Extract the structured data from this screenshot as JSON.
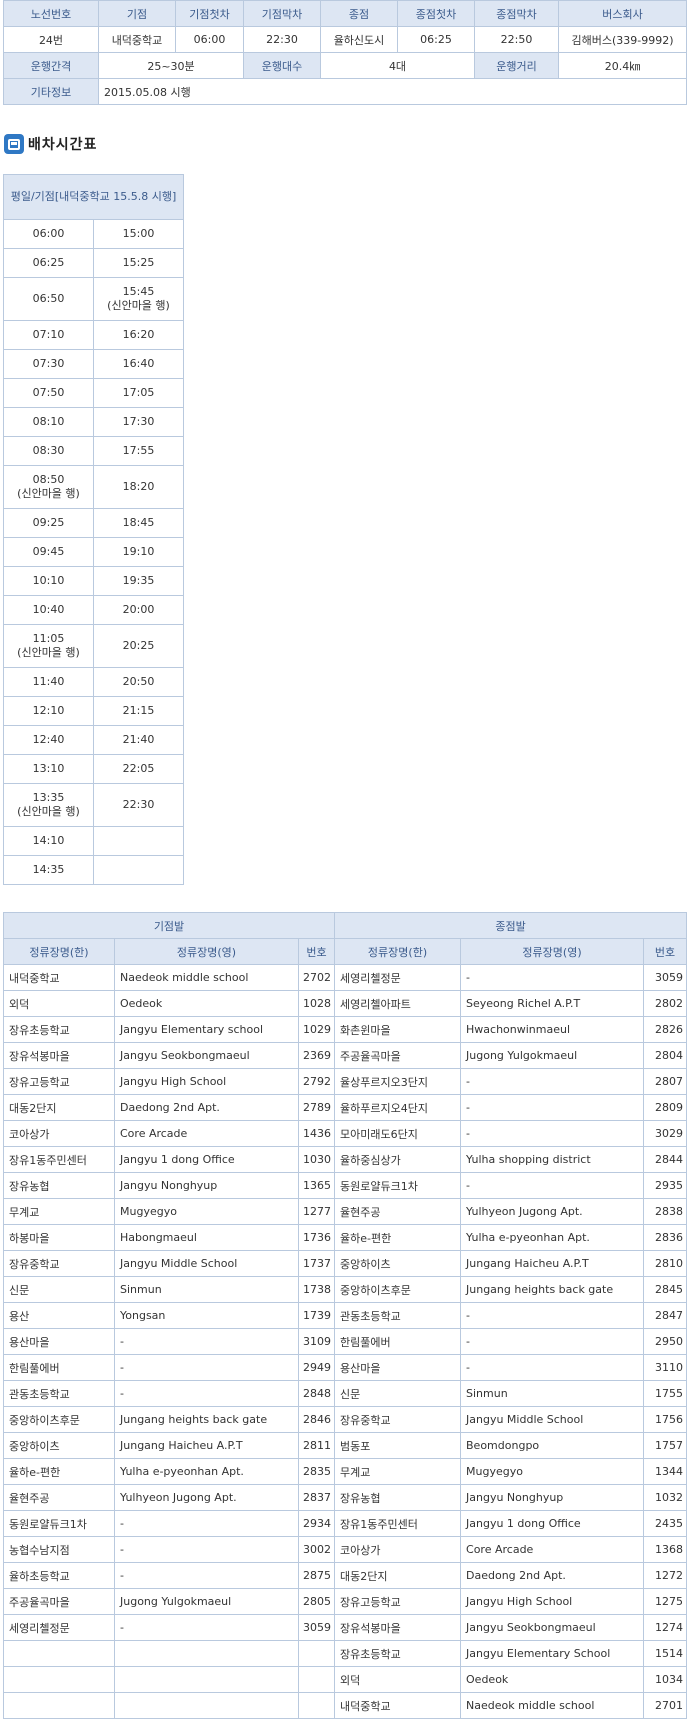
{
  "info": {
    "headers": [
      "노선번호",
      "기점",
      "기점첫차",
      "기점막차",
      "종점",
      "종점첫차",
      "종점막차",
      "버스회사"
    ],
    "values": [
      "24번",
      "내덕중학교",
      "06:00",
      "22:30",
      "율하신도시",
      "06:25",
      "22:50",
      "김해버스(339-9992)"
    ],
    "interval_label": "운행간격",
    "interval_value": "25~30분",
    "count_label": "운행대수",
    "count_value": "4대",
    "distance_label": "운행거리",
    "distance_value": "20.4㎞",
    "etc_label": "기타정보",
    "etc_value": "2015.05.08 시행"
  },
  "schedule": {
    "title": "배차시간표",
    "header": "평일/기점[내덕중학교 15.5.8 시행]",
    "rows": [
      [
        "06:00",
        "15:00"
      ],
      [
        "06:25",
        "15:25"
      ],
      [
        "06:50",
        "15:45\n(신안마을 행)"
      ],
      [
        "07:10",
        "16:20"
      ],
      [
        "07:30",
        "16:40"
      ],
      [
        "07:50",
        "17:05"
      ],
      [
        "08:10",
        "17:30"
      ],
      [
        "08:30",
        "17:55"
      ],
      [
        "08:50\n(신안마을 행)",
        "18:20"
      ],
      [
        "09:25",
        "18:45"
      ],
      [
        "09:45",
        "19:10"
      ],
      [
        "10:10",
        "19:35"
      ],
      [
        "10:40",
        "20:00"
      ],
      [
        "11:05\n(신안마을 행)",
        "20:25"
      ],
      [
        "11:40",
        "20:50"
      ],
      [
        "12:10",
        "21:15"
      ],
      [
        "12:40",
        "21:40"
      ],
      [
        "13:10",
        "22:05"
      ],
      [
        "13:35\n(신안마을 행)",
        "22:30"
      ],
      [
        "14:10",
        ""
      ],
      [
        "14:35",
        ""
      ]
    ]
  },
  "stops": {
    "origin_header": "기점발",
    "dest_header": "종점발",
    "col_ko": "정류장명(한)",
    "col_en": "정류장명(영)",
    "col_no": "번호",
    "rows": [
      [
        "내덕중학교",
        "Naedeok middle school",
        "2702",
        "세영리첼정문",
        "-",
        "3059"
      ],
      [
        "외덕",
        "Oedeok",
        "1028",
        "세영리첼아파트",
        "Seyeong Richel A.P.T",
        "2802"
      ],
      [
        "장유초등학교",
        "Jangyu Elementary school",
        "1029",
        "화촌윈마을",
        "Hwachonwinmaeul",
        "2826"
      ],
      [
        "장유석봉마을",
        "Jangyu Seokbongmaeul",
        "2369",
        "주공율곡마을",
        "Jugong Yulgokmaeul",
        "2804"
      ],
      [
        "장유고등학교",
        "Jangyu High School",
        "2792",
        "율상푸르지오3단지",
        "-",
        "2807"
      ],
      [
        "대동2단지",
        "Daedong 2nd Apt.",
        "2789",
        "율하푸르지오4단지",
        "-",
        "2809"
      ],
      [
        "코아상가",
        "Core Arcade",
        "1436",
        "모아미래도6단지",
        "-",
        "3029"
      ],
      [
        "장유1동주민센터",
        "Jangyu 1 dong Office",
        "1030",
        "율하중심상가",
        "Yulha shopping district",
        "2844"
      ],
      [
        "장유농협",
        "Jangyu Nonghyup",
        "1365",
        "동원로얄듀크1차",
        "-",
        "2935"
      ],
      [
        "무계교",
        "Mugyegyo",
        "1277",
        "율현주공",
        "Yulhyeon Jugong Apt.",
        "2838"
      ],
      [
        "하봉마을",
        "Habongmaeul",
        "1736",
        "율하e-편한",
        "Yulha e-pyeonhan Apt.",
        "2836"
      ],
      [
        "장유중학교",
        "Jangyu Middle School",
        "1737",
        "중앙하이츠",
        "Jungang Haicheu A.P.T",
        "2810"
      ],
      [
        "신문",
        "Sinmun",
        "1738",
        "중앙하이츠후문",
        "Jungang heights back gate",
        "2845"
      ],
      [
        "용산",
        "Yongsan",
        "1739",
        "관동초등학교",
        "-",
        "2847"
      ],
      [
        "용산마을",
        "-",
        "3109",
        "한림풀에버",
        "-",
        "2950"
      ],
      [
        "한림풀에버",
        "-",
        "2949",
        "용산마을",
        "-",
        "3110"
      ],
      [
        "관동초등학교",
        "-",
        "2848",
        "신문",
        "Sinmun",
        "1755"
      ],
      [
        "중앙하이츠후문",
        "Jungang heights back gate",
        "2846",
        "장유중학교",
        "Jangyu Middle School",
        "1756"
      ],
      [
        "중앙하이츠",
        "Jungang Haicheu A.P.T",
        "2811",
        "범동포",
        "Beomdongpo",
        "1757"
      ],
      [
        "율하e-편한",
        "Yulha e-pyeonhan Apt.",
        "2835",
        "무계교",
        "Mugyegyo",
        "1344"
      ],
      [
        "율현주공",
        "Yulhyeon Jugong Apt.",
        "2837",
        "장유농협",
        "Jangyu Nonghyup",
        "1032"
      ],
      [
        "동원로얄듀크1차",
        "-",
        "2934",
        "장유1동주민센터",
        "Jangyu 1 dong Office",
        "2435"
      ],
      [
        "농협수남지점",
        "-",
        "3002",
        "코아상가",
        "Core Arcade",
        "1368"
      ],
      [
        "율하초등학교",
        "-",
        "2875",
        "대동2단지",
        "Daedong 2nd Apt.",
        "1272"
      ],
      [
        "주공율곡마을",
        "Jugong Yulgokmaeul",
        "2805",
        "장유고등학교",
        "Jangyu High School",
        "1275"
      ],
      [
        "세영리첼정문",
        "-",
        "3059",
        "장유석봉마을",
        "Jangyu Seokbongmaeul",
        "1274"
      ],
      [
        "",
        "",
        "",
        "장유초등학교",
        "Jangyu Elementary School",
        "1514"
      ],
      [
        "",
        "",
        "",
        "외덕",
        "Oedeok",
        "1034"
      ],
      [
        "",
        "",
        "",
        "내덕중학교",
        "Naedeok middle school",
        "2701"
      ]
    ]
  }
}
